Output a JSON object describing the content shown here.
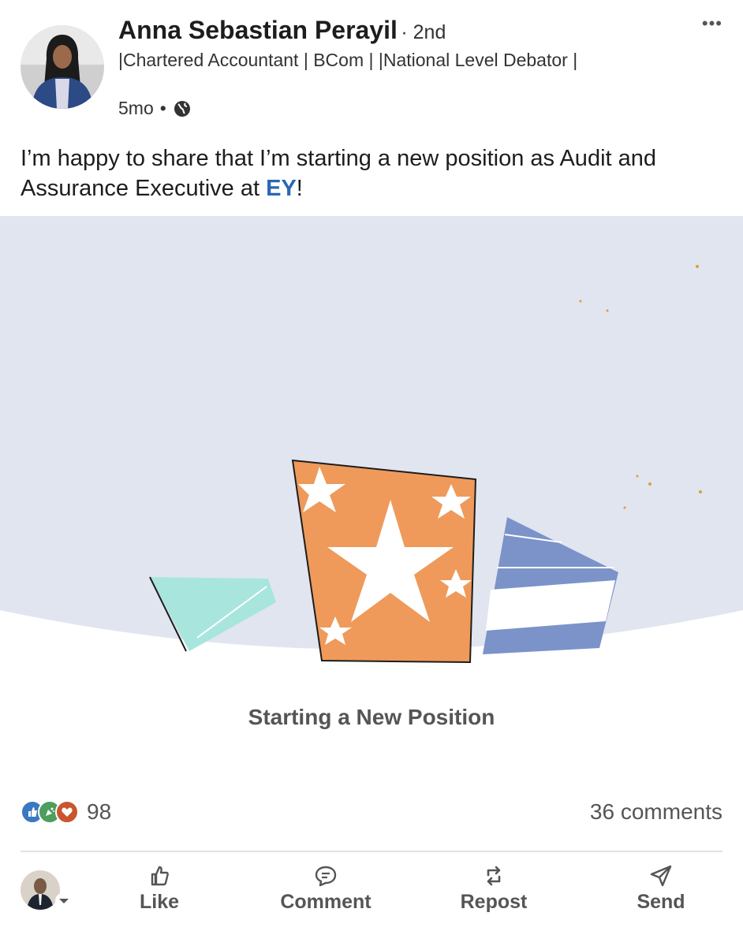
{
  "post": {
    "author": {
      "name": "Anna Sebastian Perayil",
      "degree": "· 2nd",
      "headline": "|Chartered Accountant | BCom | |National Level Debator |",
      "time": "5mo",
      "time_sep": "•",
      "visibility_icon": "globe-icon"
    },
    "more_icon": "•••",
    "text_before": "I’m happy to share that I’m starting a new position as Audit and Assurance Executive at ",
    "mention": "EY",
    "text_after": "!",
    "image_caption": "Starting a New Position",
    "reactions": {
      "icons": [
        "like-reaction-icon",
        "celebrate-reaction-icon",
        "love-reaction-icon"
      ],
      "count": "98"
    },
    "comments_count": "36 comments"
  },
  "actions": {
    "like": "Like",
    "comment": "Comment",
    "repost": "Repost",
    "send": "Send"
  },
  "colors": {
    "mention": "#2a67b6",
    "image_bg": "#e1e5ef",
    "orange_panel": "#ef9a5a",
    "teal_panel": "#a8e6dd",
    "blue_panel": "#7b93c9"
  }
}
